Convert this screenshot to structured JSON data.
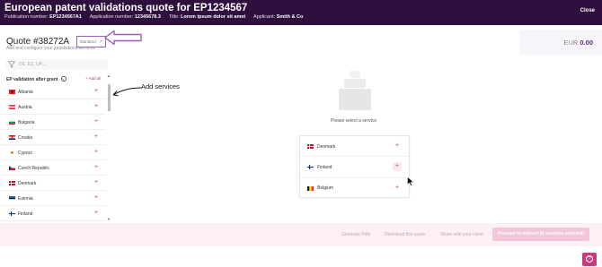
{
  "header": {
    "title": "European patent validations quote for EP1234567",
    "publication_label": "Publication number:",
    "publication_value": "EP1234567A1",
    "application_label": "Application number:",
    "application_value": "12345678.3",
    "title_label": "Title:",
    "title_value": "Lorem ipsum dolor sit amet",
    "applicant_label": "Applicant:",
    "applicant_value": "Smith & Co",
    "close_label": "Close"
  },
  "quote": {
    "title": "Quote #38272A",
    "badge_label": "Standard",
    "subtitle": "Add and configure your jurisdictions/services",
    "currency": "EUR",
    "total": "0.00"
  },
  "search": {
    "placeholder": "DE, ES, UP,..."
  },
  "panel": {
    "heading": "EP validation after grant",
    "info_glyph": "i",
    "add_all_label": "+ Add all",
    "countries": [
      {
        "name": "Albania",
        "flag": "albania"
      },
      {
        "name": "Austria",
        "flag": "austria"
      },
      {
        "name": "Bulgaria",
        "flag": "bulgaria"
      },
      {
        "name": "Croatia",
        "flag": "croatia"
      },
      {
        "name": "Cyprus",
        "flag": "cyprus"
      },
      {
        "name": "Czech Republic",
        "flag": "czech"
      },
      {
        "name": "Denmark",
        "flag": "denmark"
      },
      {
        "name": "Estonia",
        "flag": "estonia"
      },
      {
        "name": "Finland",
        "flag": "finland"
      }
    ],
    "plus_glyph": "+"
  },
  "annotation": {
    "text": "Add services"
  },
  "main": {
    "empty_message": "Please select a service",
    "services": [
      {
        "name": "Denmark",
        "flag": "denmark"
      },
      {
        "name": "Finland",
        "flag": "finland"
      },
      {
        "name": "Belgium",
        "flag": "belgium"
      }
    ]
  },
  "footer": {
    "generate_label": "Generate Pdfs",
    "download_label": "Download this quote",
    "share_label": "Share with your client",
    "proceed_label": "Proceed to instruct (0 services selected)"
  },
  "help": {
    "glyph": "?"
  },
  "colors": {
    "topbar": "#2f0f3d",
    "accent": "#c8397e",
    "annotation": "#9b5fb6"
  }
}
